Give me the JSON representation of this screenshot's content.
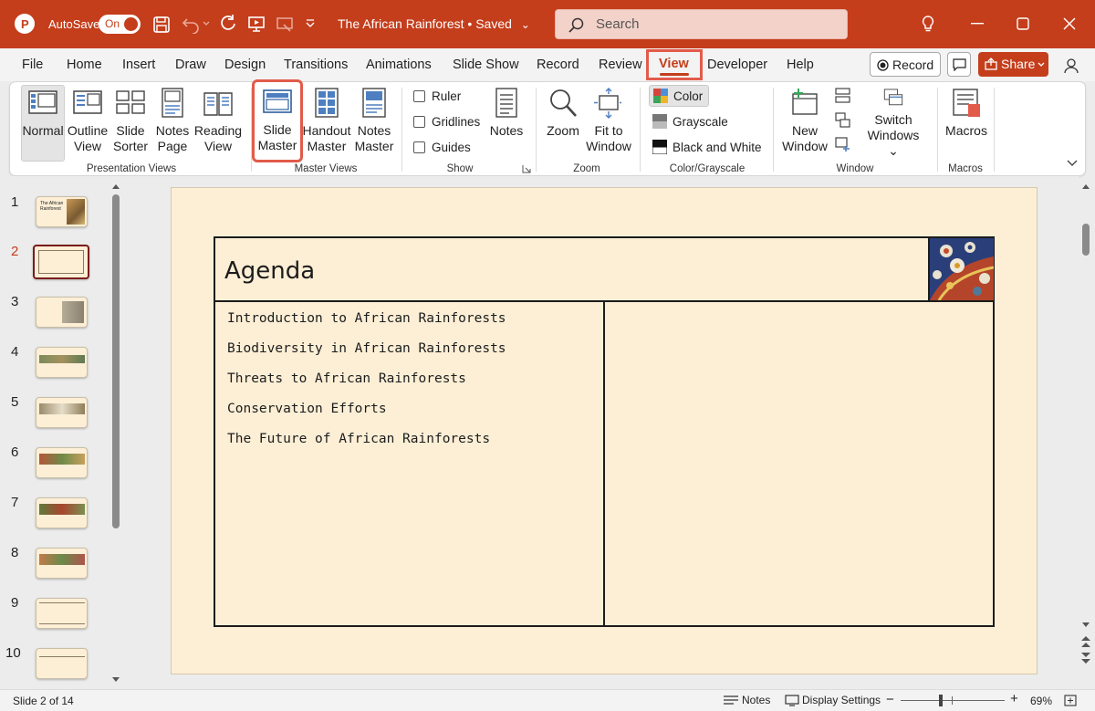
{
  "titlebar": {
    "autosave_label": "AutoSave",
    "autosave_state": "On",
    "doc_title": "The African Rainforest • Saved",
    "doc_title_caret": "⌄",
    "search_placeholder": "Search",
    "accent": "#c43e1c"
  },
  "menu": {
    "tabs": [
      "File",
      "Home",
      "Insert",
      "Draw",
      "Design",
      "Transitions",
      "Animations",
      "Slide Show",
      "Record",
      "Review",
      "View",
      "Developer",
      "Help"
    ],
    "active": "View",
    "record_label": "Record",
    "share_label": "Share"
  },
  "ribbon": {
    "presentation_views": {
      "label": "Presentation Views",
      "normal": "Normal",
      "outline": [
        "Outline",
        "View"
      ],
      "sorter": [
        "Slide",
        "Sorter"
      ],
      "notes_page": [
        "Notes",
        "Page"
      ],
      "reading": [
        "Reading",
        "View"
      ]
    },
    "master_views": {
      "label": "Master Views",
      "slide_master": [
        "Slide",
        "Master"
      ],
      "handout_master": [
        "Handout",
        "Master"
      ],
      "notes_master": [
        "Notes",
        "Master"
      ]
    },
    "show": {
      "label": "Show",
      "ruler": "Ruler",
      "gridlines": "Gridlines",
      "guides": "Guides",
      "notes": "Notes"
    },
    "zoom": {
      "label": "Zoom",
      "zoom": "Zoom",
      "fit": [
        "Fit to",
        "Window"
      ]
    },
    "color": {
      "label": "Color/Grayscale",
      "color": "Color",
      "grayscale": "Grayscale",
      "bw": "Black and White"
    },
    "window": {
      "label": "Window",
      "new_window": [
        "New",
        "Window"
      ],
      "switch": [
        "Switch",
        "Windows ⌄"
      ]
    },
    "macros": {
      "label": "Macros",
      "macros": "Macros"
    }
  },
  "thumbnails": {
    "numbers": [
      "1",
      "2",
      "3",
      "4",
      "5",
      "6",
      "7",
      "8",
      "9",
      "10"
    ],
    "selected": "2",
    "slide1_title": "The African Rainforest"
  },
  "slide": {
    "title": "Agenda",
    "items": [
      "Introduction to African Rainforests",
      "Biodiversity in African Rainforests",
      "Threats to African Rainforests",
      "Conservation Efforts",
      "The Future of African Rainforests"
    ]
  },
  "status": {
    "slide_info": "Slide 2 of 14",
    "notes": "Notes",
    "display_settings": "Display Settings",
    "zoom_minus": "−",
    "zoom_plus": "+",
    "zoom_level": "69%"
  }
}
